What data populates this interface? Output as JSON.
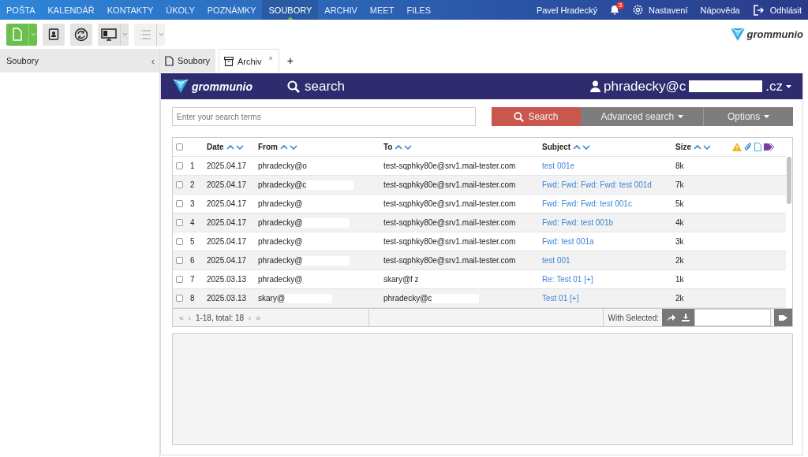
{
  "nav": {
    "items": [
      {
        "label": "POŠTA",
        "selected": false
      },
      {
        "label": "KALENDÁŘ",
        "selected": false
      },
      {
        "label": "KONTAKTY",
        "selected": false
      },
      {
        "label": "ÚKOLY",
        "selected": false
      },
      {
        "label": "POZNÁMKY",
        "selected": false
      },
      {
        "label": "SOUBORY",
        "selected": true
      },
      {
        "label": "ARCHIV",
        "selected": false
      },
      {
        "label": "MEET",
        "selected": false
      },
      {
        "label": "FILES",
        "selected": false
      }
    ],
    "user": "Pavel Hradecký",
    "notifications": "3",
    "settings": "Nastavení",
    "help": "Nápověda",
    "logout": "Odhlásit"
  },
  "toolbar": {
    "buttons": [
      {
        "kind": "new",
        "disabled": false
      },
      {
        "kind": "contacts",
        "disabled": false
      },
      {
        "kind": "sync",
        "disabled": false
      },
      {
        "kind": "view",
        "disabled": false
      },
      {
        "kind": "list",
        "disabled": true
      }
    ],
    "logo": "grommunio"
  },
  "sidebar": {
    "title": "Soubory",
    "collapse": "‹"
  },
  "tabs": [
    {
      "kind": "file",
      "label": "Soubory",
      "selected": false
    },
    {
      "kind": "archive",
      "label": "Archiv",
      "selected": true,
      "close": "×"
    }
  ],
  "new_tab": "+",
  "archive": {
    "brand": "grommunio",
    "title": "search",
    "account": "phradecky@c",
    "account_domain": ".cz",
    "search": {
      "placeholder": "Enter your search terms",
      "button": "Search",
      "advanced": "Advanced search",
      "options": "Options"
    },
    "columns": [
      "Date",
      "From",
      "To",
      "Subject",
      "Size"
    ],
    "all_checked": false,
    "rows": [
      {
        "num": "1",
        "date": "2025.04.17",
        "from": "phradecky@o",
        "from_redacted": false,
        "to": "test-sqphky80e@srv1.mail-tester.com",
        "to_redacted": false,
        "subject": "test 001e",
        "size": "8k",
        "checked": false
      },
      {
        "num": "2",
        "date": "2025.04.17",
        "from": "phradecky@c",
        "from_redacted": true,
        "to": "test-sqphky80e@srv1.mail-tester.com",
        "to_redacted": false,
        "subject": "Fwd: Fwd: Fwd: Fwd: test 001d",
        "size": "7k",
        "checked": false
      },
      {
        "num": "3",
        "date": "2025.04.17",
        "from": "phradecky@",
        "from_redacted": false,
        "to": "test-sqphky80e@srv1.mail-tester.com",
        "to_redacted": false,
        "subject": "Fwd: Fwd: Fwd: test 001c",
        "size": "5k",
        "checked": false
      },
      {
        "num": "4",
        "date": "2025.04.17",
        "from": "phradecky@",
        "from_redacted": true,
        "to": "test-sqphky80e@srv1.mail-tester.com",
        "to_redacted": false,
        "subject": "Fwd: Fwd: test 001b",
        "size": "4k",
        "checked": false
      },
      {
        "num": "5",
        "date": "2025.04.17",
        "from": "phradecky@",
        "from_redacted": false,
        "to": "test-sqphky80e@srv1.mail-tester.com",
        "to_redacted": false,
        "subject": "Fwd: test 001a",
        "size": "3k",
        "checked": false
      },
      {
        "num": "6",
        "date": "2025.04.17",
        "from": "phradecky@",
        "from_redacted": true,
        "to": "test-sqphky80e@srv1.mail-tester.com",
        "to_redacted": false,
        "subject": "test 001",
        "size": "2k",
        "checked": false
      },
      {
        "num": "7",
        "date": "2025.03.13",
        "from": "phradecky@",
        "from_redacted": false,
        "to": "skary@f z",
        "to_redacted": false,
        "subject": "Re: Test 01 [+]",
        "size": "1k",
        "checked": false
      },
      {
        "num": "8",
        "date": "2025.03.13",
        "from": "skary@",
        "from_redacted": true,
        "to": "phradecky@c",
        "to_redacted": true,
        "subject": "Test 01 [+]",
        "size": "2k",
        "checked": false
      }
    ],
    "pager": {
      "first": "«",
      "prev": "‹",
      "range": "1-18, total: 18",
      "next": "›",
      "last": "»"
    },
    "with_selected": "With Selected:"
  }
}
